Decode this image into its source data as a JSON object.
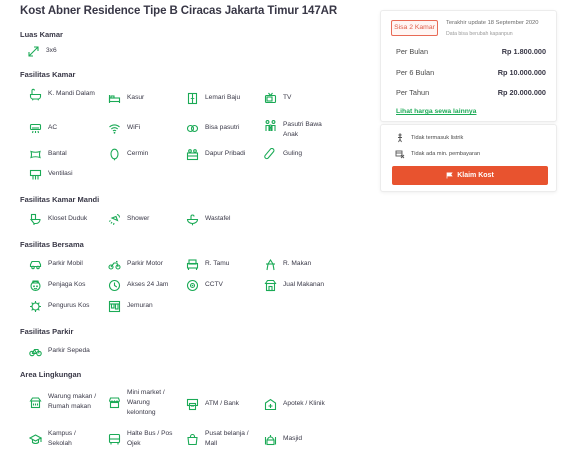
{
  "title": "Kost Abner Residence Tipe B Ciracas Jakarta Timur 147AR",
  "luas_kamar": {
    "title": "Luas Kamar",
    "value": "3x6",
    "icon": "resize-arrows-icon"
  },
  "fasilitas_kamar": {
    "title": "Fasilitas Kamar",
    "items": [
      {
        "label": "K. Mandi Dalam",
        "icon": "bathroom-icon"
      },
      {
        "label": "Kasur",
        "icon": "bed-icon"
      },
      {
        "label": "Lemari Baju",
        "icon": "wardrobe-icon"
      },
      {
        "label": "TV",
        "icon": "tv-icon"
      },
      {
        "label": "AC",
        "icon": "ac-icon"
      },
      {
        "label": "WiFi",
        "icon": "wifi-icon"
      },
      {
        "label": "Bisa pasutri",
        "icon": "couple-icon"
      },
      {
        "label": "Pasutri Bawa Anak",
        "icon": "family-icon"
      },
      {
        "label": "Bantal",
        "icon": "pillow-icon"
      },
      {
        "label": "Cermin",
        "icon": "mirror-icon"
      },
      {
        "label": "Dapur Pribadi",
        "icon": "kitchen-icon"
      },
      {
        "label": "Guling",
        "icon": "bolster-icon"
      },
      {
        "label": "Ventilasi",
        "icon": "ventilation-icon"
      }
    ]
  },
  "fasilitas_kamar_mandi": {
    "title": "Fasilitas Kamar Mandi",
    "items": [
      {
        "label": "Kloset Duduk",
        "icon": "toilet-icon"
      },
      {
        "label": "Shower",
        "icon": "shower-icon"
      },
      {
        "label": "Wastafel",
        "icon": "sink-icon"
      }
    ]
  },
  "fasilitas_bersama": {
    "title": "Fasilitas Bersama",
    "items": [
      {
        "label": "Parkir Mobil",
        "icon": "car-icon"
      },
      {
        "label": "Parkir Motor",
        "icon": "motorcycle-icon"
      },
      {
        "label": "R. Tamu",
        "icon": "sofa-icon"
      },
      {
        "label": "R. Makan",
        "icon": "dining-icon"
      },
      {
        "label": "Penjaga Kos",
        "icon": "guard-icon"
      },
      {
        "label": "Akses 24 Jam",
        "icon": "clock-icon"
      },
      {
        "label": "CCTV",
        "icon": "cctv-icon"
      },
      {
        "label": "Jual Makanan",
        "icon": "food-stall-icon"
      },
      {
        "label": "Pengurus Kos",
        "icon": "manager-icon"
      },
      {
        "label": "Jemuran",
        "icon": "clothesline-icon"
      }
    ]
  },
  "fasilitas_parkir": {
    "title": "Fasilitas Parkir",
    "items": [
      {
        "label": "Parkir Sepeda",
        "icon": "bicycle-icon"
      }
    ]
  },
  "area_lingkungan": {
    "title": "Area Lingkungan",
    "items": [
      {
        "label": "Warung makan / Rumah makan",
        "icon": "restaurant-icon"
      },
      {
        "label": "Mini market / Warung kelontong",
        "icon": "shop-icon"
      },
      {
        "label": "ATM / Bank",
        "icon": "atm-icon"
      },
      {
        "label": "Apotek / Klinik",
        "icon": "pharmacy-icon"
      },
      {
        "label": "Kampus / Sekolah",
        "icon": "school-icon"
      },
      {
        "label": "Halte Bus / Pos Ojek",
        "icon": "bus-stop-icon"
      },
      {
        "label": "Pusat belanja / Mall",
        "icon": "shopping-bag-icon"
      },
      {
        "label": "Masjid",
        "icon": "mosque-icon"
      }
    ]
  },
  "price_card": {
    "badge": "Sisa 2 Kamar",
    "update_text": "Terakhir update 18 September 2020",
    "update_sub": "Data bisa berubah kapanpun",
    "prices": [
      {
        "label": "Per Bulan",
        "value": "Rp 1.800.000"
      },
      {
        "label": "Per 6 Bulan",
        "value": "Rp 10.000.000"
      },
      {
        "label": "Per Tahun",
        "value": "Rp 20.000.000"
      }
    ],
    "link": "Lihat harga sewa lainnya"
  },
  "info_card": {
    "items": [
      {
        "label": "Tidak termasuk listrik",
        "icon": "no-electricity-icon"
      },
      {
        "label": "Tidak ada min. pembayaran",
        "icon": "no-minimum-icon"
      }
    ],
    "claim_label": "Klaim Kost"
  },
  "colors": {
    "icon_green": "#1baa56",
    "claim_button": "#e8532f",
    "badge_red": "#e05a45"
  }
}
